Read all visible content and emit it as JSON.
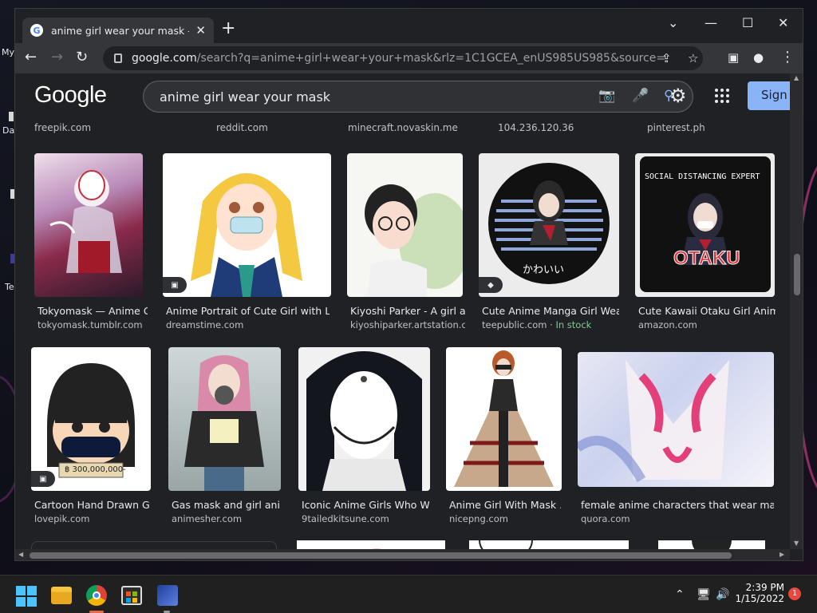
{
  "desktop": {
    "labels": [
      "My",
      "Da",
      "Te"
    ]
  },
  "browser": {
    "tab_title": "anime girl wear your mask - Goo",
    "new_tab": "+",
    "url_host": "google.com",
    "url_rest": "/search?q=anime+girl+wear+your+mask&rlz=1C1GCEA_enUS985US985&source=lnms&tbm=..."
  },
  "google": {
    "logo": "Google",
    "query": "anime girl wear your mask",
    "sign_in": "Sign i"
  },
  "prev_row_sources": [
    "freepik.com",
    "reddit.com",
    "minecraft.novaskin.me",
    "104.236.120.36",
    "pinterest.ph"
  ],
  "results_row1": [
    {
      "caption": "Tokyomask — Anime Gi…",
      "source": "tokyomask.tumblr.com",
      "badge": ""
    },
    {
      "caption": "Anime Portrait of Cute Girl with Lo…",
      "source": "dreamstime.com",
      "badge": "image"
    },
    {
      "caption": "Kiyoshi Parker - A girl a…",
      "source": "kiyoshiparker.artstation.c…",
      "badge": ""
    },
    {
      "caption": "Cute Anime Manga Girl Wear…",
      "source": "teepublic.com",
      "stock": "In stock",
      "badge": "tag"
    },
    {
      "caption": "Cute Kawaii Otaku Girl Anim…",
      "source": "amazon.com",
      "badge": ""
    }
  ],
  "results_row2": [
    {
      "caption": "Cartoon Hand Drawn Gir…",
      "source": "lovepik.com",
      "badge": "image"
    },
    {
      "caption": "Gas mask and girl ani…",
      "source": "animesher.com",
      "badge": ""
    },
    {
      "caption": "Iconic Anime Girls Who We…",
      "source": "9tailedkitsune.com",
      "badge": ""
    },
    {
      "caption": "Anime Girl With Mask …",
      "source": "nicepng.com",
      "badge": ""
    },
    {
      "caption": "female anime characters that wear mask…",
      "source": "quora.com",
      "badge": ""
    }
  ],
  "image_text": {
    "pillow_top": "SOCIAL DISTANCING EXPERT",
    "pillow_bottom": "OTAKU",
    "button_jp": "かわいい",
    "sign_text": "฿ 300,000,000-"
  },
  "taskbar": {
    "time": "2:39 PM",
    "date": "1/15/2022",
    "notifications": "1"
  },
  "colors": {
    "page_bg": "#202124",
    "sign_in_bg": "#8ab4f8",
    "in_stock": "#81c995"
  }
}
